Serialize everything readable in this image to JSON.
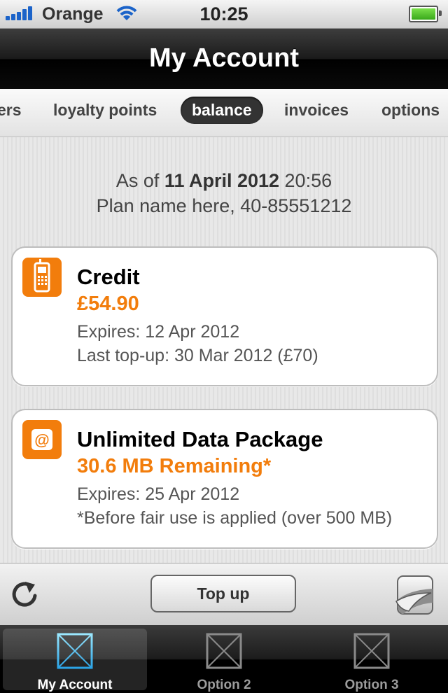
{
  "status_bar": {
    "carrier": "Orange",
    "time": "10:25",
    "signal_bars": 5,
    "battery_level": 1.0
  },
  "title": "My Account",
  "segments": [
    {
      "label": "ers"
    },
    {
      "label": "loyalty points"
    },
    {
      "label": "balance",
      "selected": true
    },
    {
      "label": "invoices"
    },
    {
      "label": "options"
    }
  ],
  "summary": {
    "as_of_prefix": "As of ",
    "as_of_date": "11 April 2012",
    "as_of_time": " 20:56",
    "plan": "Plan name here, 40-85551212"
  },
  "cards": [
    {
      "icon": "phone-icon",
      "title": "Credit",
      "amount": "£54.90",
      "line1": "Expires: 12 Apr 2012",
      "line2": "Last top-up: 30 Mar 2012 (£70)"
    },
    {
      "icon": "at-sign-icon",
      "title": "Unlimited Data Package",
      "amount": "30.6 MB Remaining*",
      "line1": "Expires: 25 Apr 2012",
      "line2": "*Before fair use is applied (over 500 MB)"
    }
  ],
  "toolbar": {
    "refresh_icon": "refresh-icon",
    "topup_label": "Top up",
    "pagecurl_icon": "page-curl-icon"
  },
  "tab_bar": [
    {
      "label": "My Account",
      "active": true
    },
    {
      "label": "Option 2"
    },
    {
      "label": "Option 3"
    }
  ],
  "colors": {
    "accent": "#f27d0c",
    "signal": "#1b63c9",
    "battery": "#4cc22a"
  }
}
